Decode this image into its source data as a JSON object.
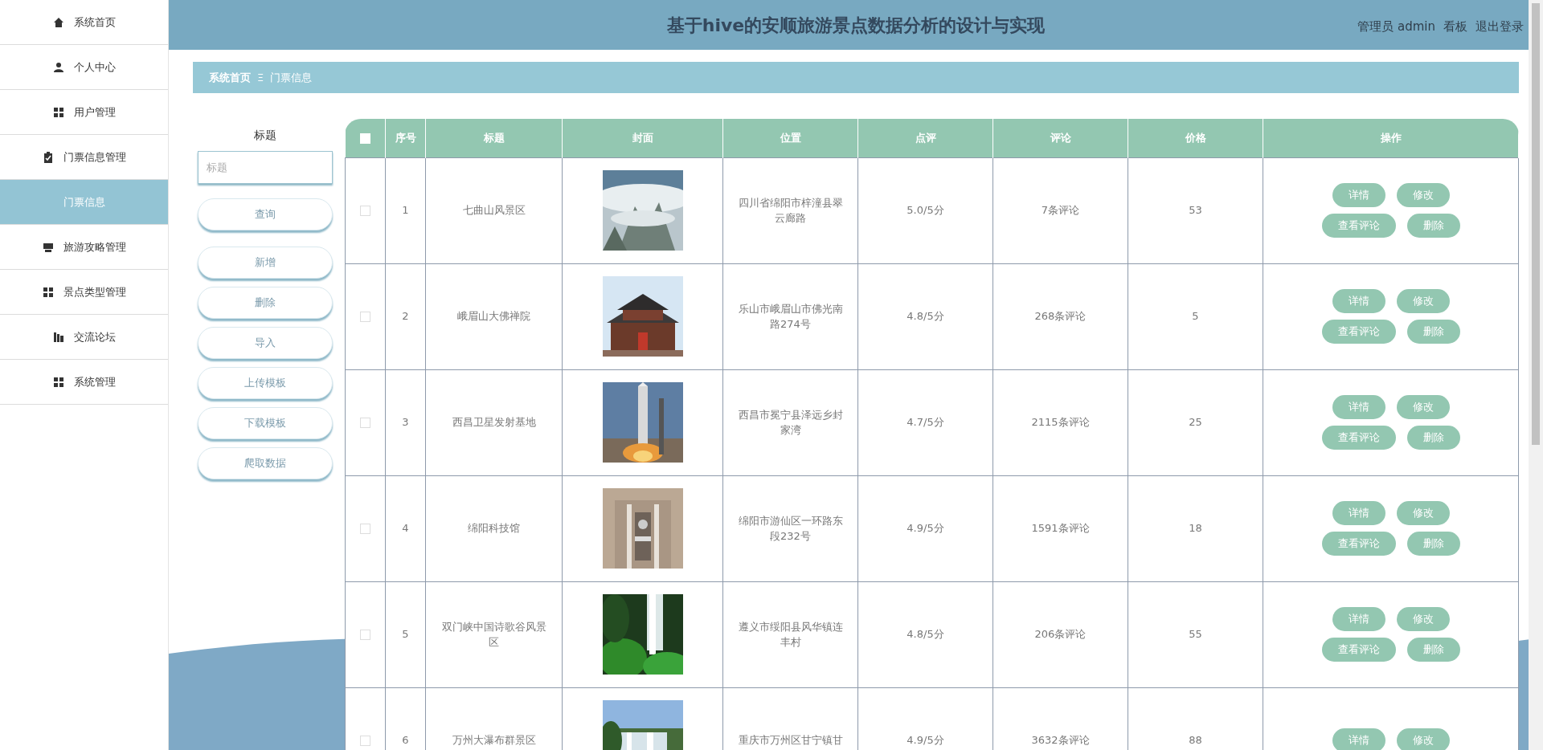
{
  "sidebar": {
    "items": [
      {
        "label": "系统首页",
        "selected": false
      },
      {
        "label": "个人中心",
        "selected": false
      },
      {
        "label": "用户管理",
        "selected": false
      },
      {
        "label": "门票信息管理",
        "selected": false,
        "children": [
          {
            "label": "门票信息",
            "selected": true
          }
        ]
      },
      {
        "label": "旅游攻略管理",
        "selected": false
      },
      {
        "label": "景点类型管理",
        "selected": false
      },
      {
        "label": "交流论坛",
        "selected": false
      },
      {
        "label": "系统管理",
        "selected": false
      }
    ]
  },
  "header": {
    "title": "基于hive的安顺旅游景点数据分析的设计与实现",
    "links": [
      "管理员 admin",
      "看板",
      "退出登录"
    ]
  },
  "breadcrumb": {
    "items": [
      "系统首页",
      "门票信息"
    ],
    "separator": "Ξ"
  },
  "search": {
    "label": "标题",
    "placeholder": "标题"
  },
  "buttons": [
    "查询",
    "新增",
    "删除",
    "导入",
    "上传模板",
    "下载模板",
    "爬取数据"
  ],
  "table": {
    "select_all_checked": false,
    "columns": [
      "序号",
      "标题",
      "封面",
      "位置",
      "点评",
      "评论",
      "价格",
      "操作"
    ],
    "rows": [
      {
        "checked": false,
        "no": "1",
        "title": "七曲山风景区",
        "location": "四川省绵阳市梓潼县翠云廊路",
        "rating": "5.0/5分",
        "comments": "7条评论",
        "price": "53",
        "actions": [
          "详情",
          "修改",
          "查看评论",
          "删除"
        ]
      },
      {
        "checked": false,
        "no": "2",
        "title": "峨眉山大佛禅院",
        "location": "乐山市峨眉山市佛光南路274号",
        "rating": "4.8/5分",
        "comments": "268条评论",
        "price": "5",
        "actions": [
          "详情",
          "修改",
          "查看评论",
          "删除"
        ]
      },
      {
        "checked": false,
        "no": "3",
        "title": "西昌卫星发射基地",
        "location": "西昌市冕宁县泽远乡封家湾",
        "rating": "4.7/5分",
        "comments": "2115条评论",
        "price": "25",
        "actions": [
          "详情",
          "修改",
          "查看评论",
          "删除"
        ]
      },
      {
        "checked": false,
        "no": "4",
        "title": "绵阳科技馆",
        "location": "绵阳市游仙区一环路东段232号",
        "rating": "4.9/5分",
        "comments": "1591条评论",
        "price": "18",
        "actions": [
          "详情",
          "修改",
          "查看评论",
          "删除"
        ]
      },
      {
        "checked": false,
        "no": "5",
        "title": "双门峡中国诗歌谷风景区",
        "location": "遵义市绥阳县风华镇连丰村",
        "rating": "4.8/5分",
        "comments": "206条评论",
        "price": "55",
        "actions": [
          "详情",
          "修改",
          "查看评论",
          "删除"
        ]
      },
      {
        "checked": false,
        "no": "6",
        "title": "万州大瀑布群景区",
        "location": "重庆市万州区甘宁镇甘",
        "rating": "4.9/5分",
        "comments": "3632条评论",
        "price": "88",
        "actions": [
          "详情",
          "修改"
        ]
      }
    ]
  }
}
